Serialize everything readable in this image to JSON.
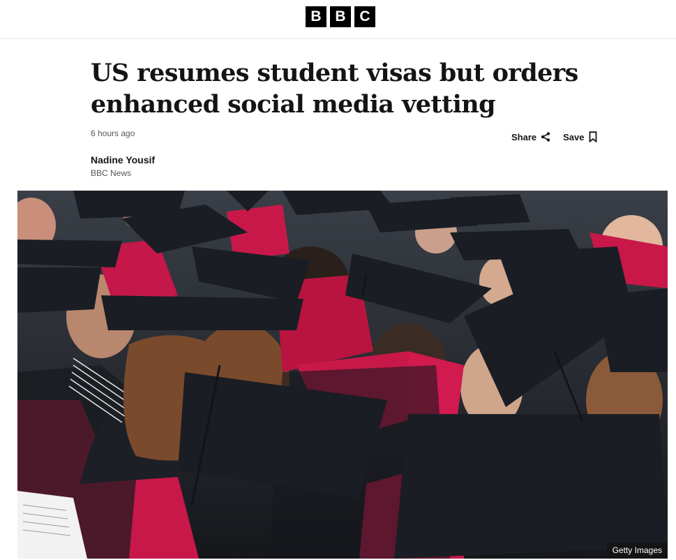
{
  "brand": {
    "letters": [
      "B",
      "B",
      "C"
    ]
  },
  "article": {
    "headline": "US resumes student visas but orders enhanced social media vetting",
    "timestamp": "6 hours ago",
    "author": "Nadine Yousif",
    "organisation": "BBC News"
  },
  "actions": {
    "share_label": "Share",
    "save_label": "Save",
    "share_icon": "share-icon",
    "save_icon": "bookmark-icon"
  },
  "image": {
    "alt": "Graduates wearing black mortarboard caps and crimson hoods",
    "credit": "Getty Images"
  },
  "colors": {
    "brand": "#000000",
    "hood": "#c8184a",
    "cap": "#1a1d24"
  }
}
